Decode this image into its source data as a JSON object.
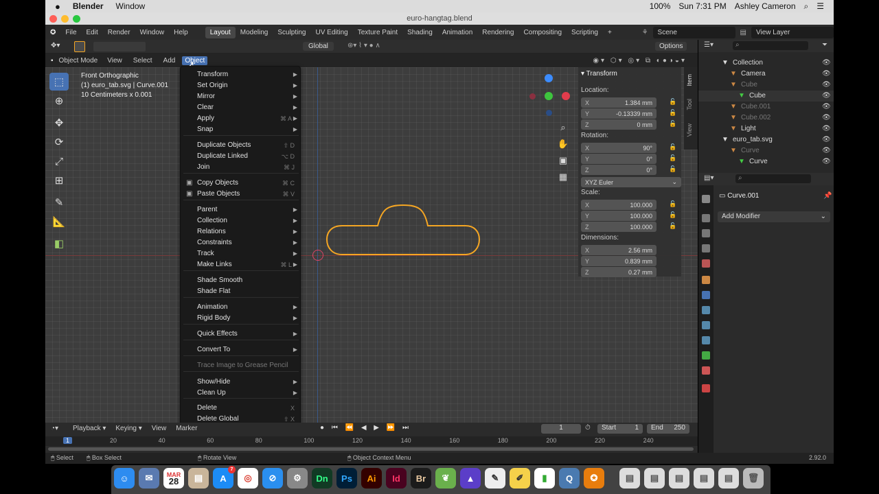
{
  "mac_menubar": {
    "app": "Blender",
    "menu": "Window",
    "clock": "Sun 7:31 PM",
    "user": "Ashley Cameron",
    "battery": "100%"
  },
  "window_title": "euro-hangtag.blend",
  "topbar": {
    "menus": [
      "File",
      "Edit",
      "Render",
      "Window",
      "Help"
    ],
    "workspaces": [
      "Layout",
      "Modeling",
      "Sculpting",
      "UV Editing",
      "Texture Paint",
      "Shading",
      "Animation",
      "Rendering",
      "Compositing",
      "Scripting"
    ],
    "active_workspace": "Layout",
    "add": "+",
    "scene": "Scene",
    "view_layer": "View Layer"
  },
  "viewport_header": {
    "mode": "Object Mode",
    "menus": [
      "View",
      "Select",
      "Add",
      "Object"
    ],
    "transform_orientation": "Global",
    "options": "Options"
  },
  "viewport_info": {
    "line1": "Front Orthographic",
    "line2": "(1) euro_tab.svg | Curve.001",
    "line3": "10 Centimeters x 0.001"
  },
  "object_menu": {
    "items": [
      {
        "label": "Transform",
        "submenu": true
      },
      {
        "label": "Set Origin",
        "submenu": true
      },
      {
        "label": "Mirror",
        "submenu": true
      },
      {
        "label": "Clear",
        "submenu": true
      },
      {
        "label": "Apply",
        "submenu": true,
        "shortcut": "⌘ A"
      },
      {
        "label": "Snap",
        "submenu": true
      },
      {
        "label": "Duplicate Objects",
        "shortcut": "⇧ D"
      },
      {
        "label": "Duplicate Linked",
        "shortcut": "⌥ D"
      },
      {
        "label": "Join",
        "shortcut": "⌘ J"
      },
      {
        "label": "Copy Objects",
        "shortcut": "⌘ C"
      },
      {
        "label": "Paste Objects",
        "shortcut": "⌘ V"
      },
      {
        "label": "Parent",
        "submenu": true
      },
      {
        "label": "Collection",
        "submenu": true
      },
      {
        "label": "Relations",
        "submenu": true
      },
      {
        "label": "Constraints",
        "submenu": true
      },
      {
        "label": "Track",
        "submenu": true
      },
      {
        "label": "Make Links",
        "submenu": true,
        "shortcut": "⌘ L"
      },
      {
        "label": "Shade Smooth"
      },
      {
        "label": "Shade Flat"
      },
      {
        "label": "Animation",
        "submenu": true
      },
      {
        "label": "Rigid Body",
        "submenu": true
      },
      {
        "label": "Quick Effects",
        "submenu": true
      },
      {
        "label": "Convert To",
        "submenu": true
      },
      {
        "label": "Trace Image to Grease Pencil",
        "disabled": true
      },
      {
        "label": "Show/Hide",
        "submenu": true
      },
      {
        "label": "Clean Up",
        "submenu": true
      },
      {
        "label": "Delete",
        "shortcut": "X"
      },
      {
        "label": "Delete Global",
        "shortcut": "⇧ X"
      }
    ]
  },
  "npanel": {
    "header": "Transform",
    "tabs": [
      "Item",
      "Tool",
      "View"
    ],
    "location_label": "Location:",
    "location": [
      {
        "axis": "X",
        "value": "1.384 mm"
      },
      {
        "axis": "Y",
        "value": "-0.13339 mm"
      },
      {
        "axis": "Z",
        "value": "0 mm"
      }
    ],
    "rotation_label": "Rotation:",
    "rotation": [
      {
        "axis": "X",
        "value": "90°"
      },
      {
        "axis": "Y",
        "value": "0°"
      },
      {
        "axis": "Z",
        "value": "0°"
      }
    ],
    "rotation_mode": "XYZ Euler",
    "scale_label": "Scale:",
    "scale": [
      {
        "axis": "X",
        "value": "100.000"
      },
      {
        "axis": "Y",
        "value": "100.000"
      },
      {
        "axis": "Z",
        "value": "100.000"
      }
    ],
    "dimensions_label": "Dimensions:",
    "dimensions": [
      {
        "axis": "X",
        "value": "2.56 mm"
      },
      {
        "axis": "Y",
        "value": "0.839 mm"
      },
      {
        "axis": "Z",
        "value": "0.27 mm"
      }
    ]
  },
  "outliner": {
    "rows": [
      {
        "label": "Collection"
      },
      {
        "label": "Camera"
      },
      {
        "label": "Cube",
        "dim": true
      },
      {
        "label": "Cube"
      },
      {
        "label": "Cube.001",
        "dim": true
      },
      {
        "label": "Cube.002",
        "dim": true
      },
      {
        "label": "Light"
      },
      {
        "label": "euro_tab.svg"
      },
      {
        "label": "Curve",
        "dim": true
      },
      {
        "label": "Curve"
      }
    ]
  },
  "properties": {
    "object_name": "Curve.001",
    "add_modifier": "Add Modifier"
  },
  "timeline": {
    "menus": [
      "Playback",
      "Keying",
      "View",
      "Marker"
    ],
    "current_frame": "1",
    "start_label": "Start",
    "start": "1",
    "end_label": "End",
    "end": "250",
    "ruler": [
      "20",
      "40",
      "60",
      "80",
      "100",
      "120",
      "140",
      "160",
      "180",
      "200",
      "220",
      "240"
    ],
    "ruler_current": "1"
  },
  "statusbar": {
    "select": "Select",
    "box_select": "Box Select",
    "rotate_view": "Rotate View",
    "context_menu": "Object Context Menu",
    "version": "2.92.0"
  },
  "dock": {
    "apps": [
      "Dn",
      "Ps",
      "Ai",
      "Id",
      "Br"
    ],
    "calendar_month": "MAR",
    "calendar_day": "28",
    "mail_badge": "7"
  }
}
